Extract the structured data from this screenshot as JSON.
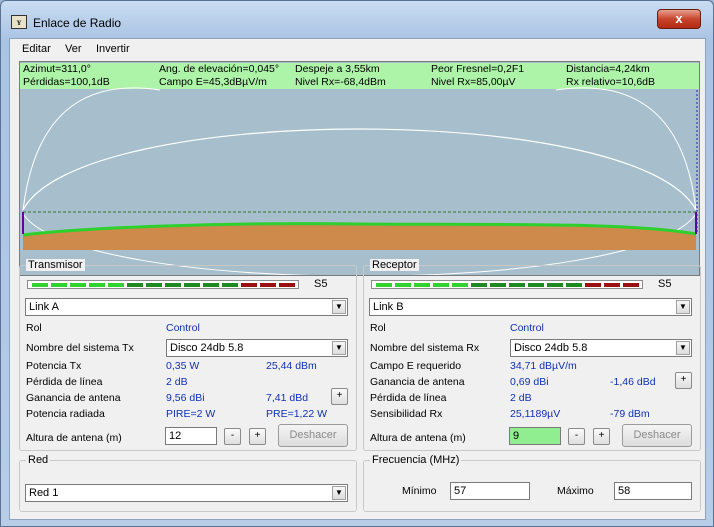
{
  "window": {
    "title": "Enlace de Radio",
    "icon": "radio-mobile-app-icon",
    "close_label": "x"
  },
  "menu": [
    "Editar",
    "Ver",
    "Invertir"
  ],
  "info": {
    "row1": [
      "Azimut=311,0°",
      "Ang. de elevación=0,045°",
      "Despeje a 3,55km",
      "Peor Fresnel=0,2F1",
      "Distancia=4,24km"
    ],
    "row2": [
      "Pérdidas=100,1dB",
      "Campo E=45,3dBµV/m",
      "Nivel Rx=-68,4dBm",
      "Nivel Rx=85,00µV",
      "Rx relativo=10,6dB"
    ]
  },
  "colors": {
    "info_bg": "#adf3a8",
    "profile_bg": "#a7bfcc",
    "terrain": "#cd8a4b",
    "terrain_edge": "#2ed02e",
    "fresnel": "#ffffff",
    "los": "#2a7a2a"
  },
  "transmisor": {
    "legend": "Transmisor",
    "signal_label": "S5",
    "unit_select": "Link A",
    "rol_label": "Rol",
    "rol_value": "Control",
    "system_label": "Nombre del sistema Tx",
    "system_value": "Disco 24db 5.8",
    "rows": [
      {
        "label": "Potencia Tx",
        "v1": "0,35 W",
        "v2": "25,44 dBm"
      },
      {
        "label": "Pérdida de línea",
        "v1": "2 dB",
        "v2": ""
      },
      {
        "label": "Ganancia de antena",
        "v1": "9,56 dBi",
        "v2": "7,41 dBd"
      },
      {
        "label": "Potencia radiada",
        "v1": "PIRE=2 W",
        "v2": "PRE=1,22 W"
      }
    ],
    "height_label": "Altura de antena (m)",
    "height_value": "12",
    "minus": "-",
    "plus": "+",
    "gain_plus": "+",
    "undo": "Deshacer"
  },
  "receptor": {
    "legend": "Receptor",
    "signal_label": "S5",
    "unit_select": "Link B",
    "rol_label": "Rol",
    "rol_value": "Control",
    "system_label": "Nombre del sistema Rx",
    "system_value": "Disco 24db 5.8",
    "rows": [
      {
        "label": "Campo E requerido",
        "v1": "34,71 dBµV/m",
        "v2": ""
      },
      {
        "label": "Ganancia de antena",
        "v1": "0,69 dBi",
        "v2": "-1,46 dBd"
      },
      {
        "label": "Pérdida de línea",
        "v1": "2 dB",
        "v2": ""
      },
      {
        "label": "Sensibilidad Rx",
        "v1": "25,1189µV",
        "v2": "-79 dBm"
      }
    ],
    "height_label": "Altura de antena (m)",
    "height_value": "9",
    "minus": "-",
    "plus": "+",
    "gain_plus": "+",
    "undo": "Deshacer"
  },
  "red": {
    "legend": "Red",
    "value": "Red  1"
  },
  "frecuencia": {
    "legend": "Frecuencia (MHz)",
    "min_label": "Mínimo",
    "min_value": "57",
    "max_label": "Máximo",
    "max_value": "58"
  },
  "signal_segments": [
    "#2fd22f",
    "#2fd22f",
    "#2fd22f",
    "#2fd22f",
    "#2fd22f",
    "#1f8a1f",
    "#1f8a1f",
    "#1f8a1f",
    "#1f8a1f",
    "#1f8a1f",
    "#1f8a1f",
    "#9a1010",
    "#9a1010",
    "#9a1010"
  ]
}
